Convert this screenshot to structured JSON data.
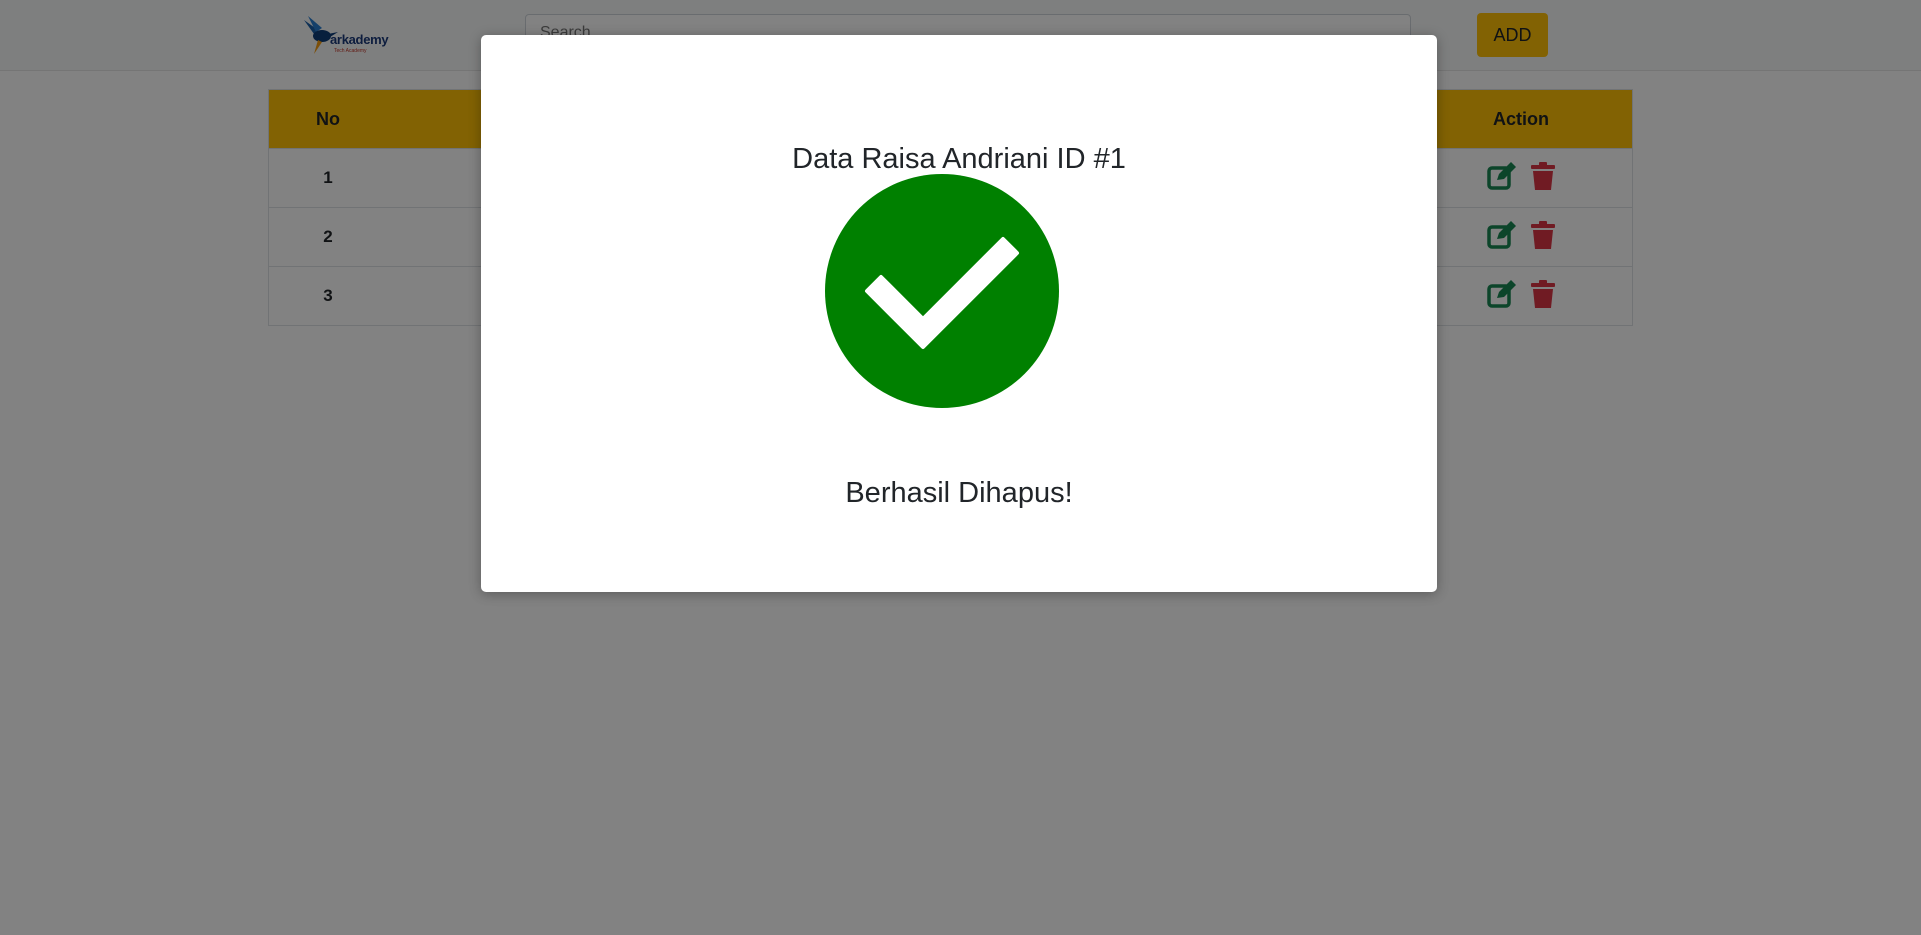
{
  "header": {
    "logo_text": "arkademy",
    "logo_subtext": "Tech Academy",
    "search_placeholder": "Search...",
    "add_label": "ADD"
  },
  "table": {
    "columns": [
      "No",
      "Action"
    ],
    "rows": [
      {
        "no": "1"
      },
      {
        "no": "2"
      },
      {
        "no": "3"
      }
    ]
  },
  "icons": {
    "edit": "edit-icon",
    "delete": "trash-icon",
    "success": "check-circle-icon"
  },
  "colors": {
    "accent": "#ffc107",
    "edit": "#198754",
    "delete": "#dc3545",
    "success": "#008000"
  },
  "modal": {
    "title": "Data Raisa Andriani ID #1",
    "message": "Berhasil Dihapus!"
  }
}
